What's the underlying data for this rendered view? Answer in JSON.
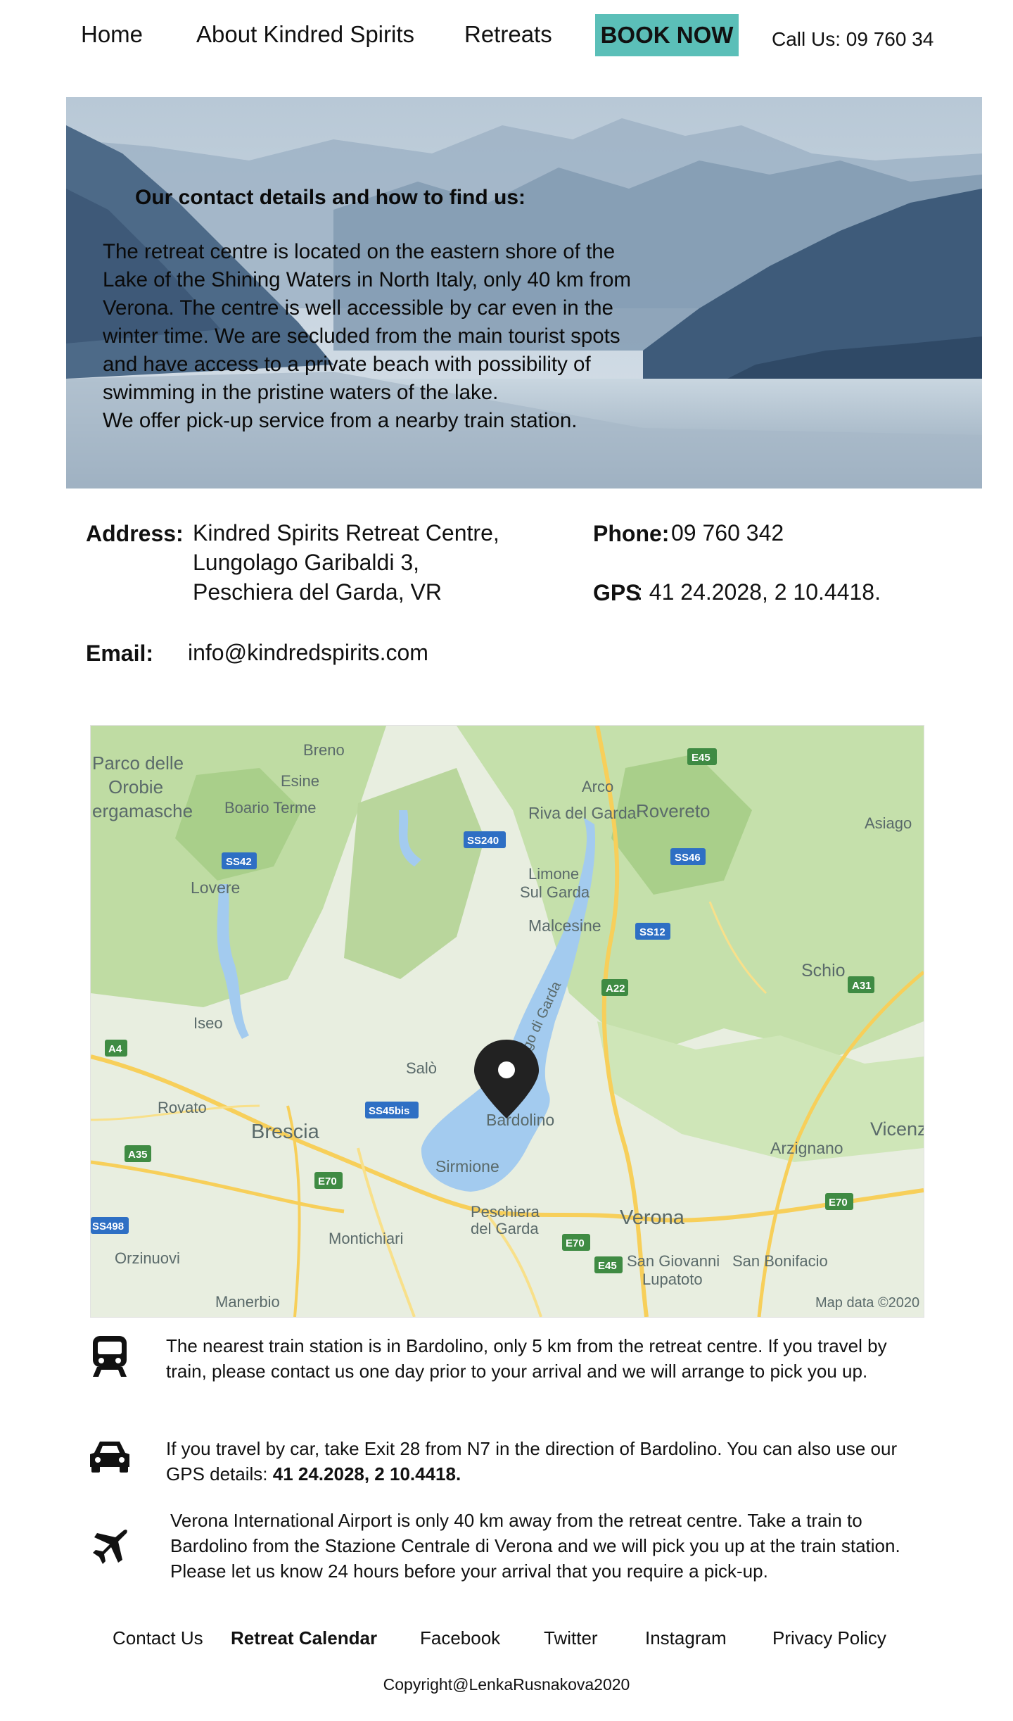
{
  "nav": {
    "home": "Home",
    "about": "About Kindred Spirits",
    "retreats": "Retreats",
    "book_now": "BOOK NOW",
    "call_us": "Call Us: 09 760 34"
  },
  "hero": {
    "title": "Our contact details and how to find us:",
    "body": "The retreat centre is located on the eastern shore of the\nLake of the Shining Waters in North Italy, only 40 km from\nVerona. The centre is well accessible by car even in the\nwinter time. We are secluded from the main tourist spots\nand have access to a private beach with possibility of\nswimming in the pristine waters of the lake.\nWe offer pick-up service from a nearby train station."
  },
  "contact": {
    "address_label": "Address:",
    "address_lines": [
      "Kindred Spirits Retreat Centre,",
      "Lungolago Garibaldi 3,",
      "Peschiera del Garda, VR"
    ],
    "phone_label": "Phone:",
    "phone_value": " 09 760 342",
    "gps_label": "GPS",
    "gps_value": ": 41 24.2028, 2 10.4418.",
    "email_label": "Email:",
    "email_value": "info@kindredspirits.com"
  },
  "map": {
    "places": {
      "parco1": "Parco delle",
      "parco2": "Orobie",
      "parco3": "ergamasche",
      "breno": "Breno",
      "esine": "Esine",
      "boario": "Boario Terme",
      "arco": "Arco",
      "riva": "Riva del Garda",
      "rovereto": "Rovereto",
      "asiago": "Asiago",
      "lovere": "Lovere",
      "limone1": "Limone",
      "limone2": "Sul Garda",
      "malcesine": "Malcesine",
      "schio": "Schio",
      "iseo": "Iseo",
      "lago": "Lago di Garda",
      "salo": "Salò",
      "rovato": "Rovato",
      "brescia": "Brescia",
      "bardolino": "Bardolino",
      "vicenza": "Vicenz",
      "arzignano": "Arzignano",
      "sirmione": "Sirmione",
      "peschiera1": "Peschiera",
      "peschiera2": "del Garda",
      "verona": "Verona",
      "montichiari": "Montichiari",
      "orzinuovi": "Orzinuovi",
      "sangiovanni1": "San Giovanni",
      "sangiovanni2": "Lupatoto",
      "sanbonifacio": "San Bonifacio",
      "manerbio": "Manerbio"
    },
    "roads": {
      "e45a": "E45",
      "ss240": "SS240",
      "ss42": "SS42",
      "ss46": "SS46",
      "ss12": "SS12",
      "a22": "A22",
      "a31": "A31",
      "a4": "A4",
      "ss45bis": "SS45bis",
      "a35": "A35",
      "e70a": "E70",
      "e70b": "E70",
      "e70c": "E70",
      "ss498": "SS498",
      "e45b": "E45"
    },
    "attribution": "Map data ©2020"
  },
  "travel": [
    {
      "icon": "train-icon",
      "text": "The nearest train station is in Bardolino, only 5 km from the retreat centre. If you travel by train, please contact us one day prior to your arrival and we will arrange to pick you up."
    },
    {
      "icon": "car-icon",
      "text": "If you travel by car, take Exit 28 from N7 in the direction of Bardolino. You can also use our GPS details: ",
      "bold": "41 24.2028, 2 10.4418."
    },
    {
      "icon": "airplane-icon",
      "text": "Verona International Airport is only 40 km away from the retreat centre. Take a train to Bardolino from the Stazione Centrale di Verona and we will pick you up at the train station. Please let us know 24 hours before your arrival that you require a pick-up."
    }
  ],
  "footer": {
    "contact": "Contact Us",
    "calendar": "Retreat Calendar",
    "facebook": "Facebook",
    "twitter": "Twitter",
    "instagram": "Instagram",
    "privacy": "Privacy Policy",
    "copyright": "Copyright@LenkaRusnakova2020"
  },
  "colors": {
    "accent": "#5bbfb8",
    "lake": "#a3cbef",
    "map_green": "#bfdca3"
  }
}
